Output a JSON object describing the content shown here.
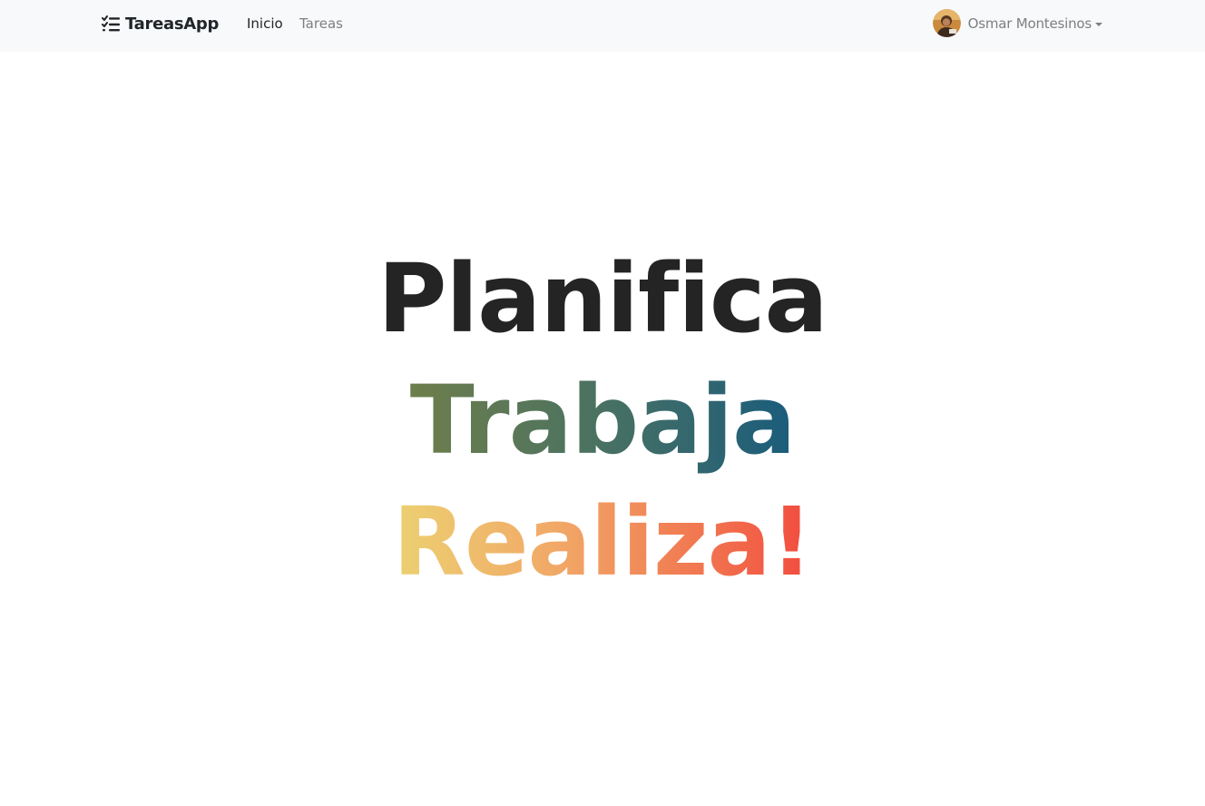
{
  "navbar": {
    "brand": {
      "icon": "checklist-icon",
      "label": "TareasApp"
    },
    "links": [
      {
        "label": "Inicio",
        "active": true
      },
      {
        "label": "Tareas",
        "active": false
      }
    ],
    "user": {
      "avatar": "user-avatar",
      "name": "Osmar Montesinos",
      "dropdown_icon": "caret-down-icon"
    }
  },
  "hero": {
    "line1": "Planifica",
    "line2": "Trabaja",
    "line3": "Realiza!"
  },
  "colors": {
    "navbar_bg": "#f8f9fa",
    "text_dark": "#242424",
    "muted": "#7c7f83",
    "gradient_green_blue": [
      "#6e7e4b",
      "#1a5c7c"
    ],
    "gradient_yellow_red": [
      "#ecd172",
      "#f24a3e"
    ]
  }
}
